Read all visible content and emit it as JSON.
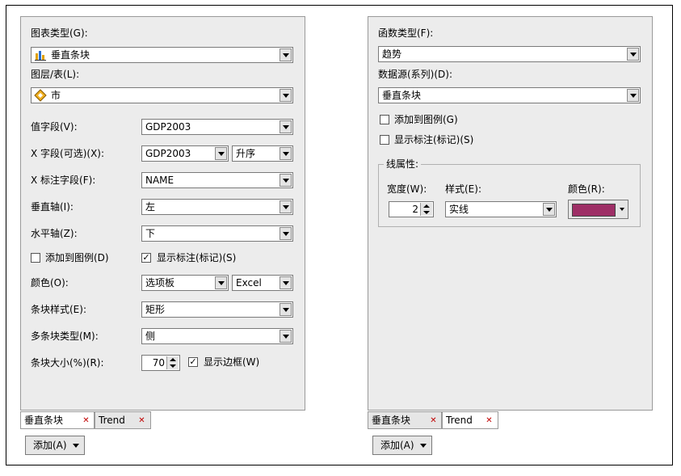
{
  "left": {
    "chart_type_label": "图表类型(G):",
    "chart_type_value": "垂直条块",
    "layer_label": "图层/表(L):",
    "layer_value": "市",
    "value_field_label": "值字段(V):",
    "value_field_value": "GDP2003",
    "x_field_label": "X 字段(可选)(X):",
    "x_field_value": "GDP2003",
    "sort_value": "升序",
    "x_label_field_label": "X 标注字段(F):",
    "x_label_field_value": "NAME",
    "vertical_axis_label": "垂直轴(I):",
    "vertical_axis_value": "左",
    "horizontal_axis_label": "水平轴(Z):",
    "horizontal_axis_value": "下",
    "add_legend_label": "添加到图例(D)",
    "add_legend_checked": "",
    "show_labels_label": "显示标注(标记)(S)",
    "show_labels_checked": "✓",
    "color_label": "颜色(O):",
    "color_scheme_value": "选项板",
    "palette_value": "Excel",
    "bar_style_label": "条块样式(E):",
    "bar_style_value": "矩形",
    "multi_bar_label": "多条块类型(M):",
    "multi_bar_value": "侧",
    "bar_size_label": "条块大小(%)(R):",
    "bar_size_value": "70",
    "show_border_label": "显示边框(W)",
    "show_border_checked": "✓",
    "tabs": [
      {
        "label": "垂直条块"
      },
      {
        "label": "Trend"
      }
    ],
    "add_button_label": "添加(A)"
  },
  "right": {
    "function_type_label": "函数类型(F):",
    "function_type_value": "趋势",
    "data_source_label": "数据源(系列)(D):",
    "data_source_value": "垂直条块",
    "add_legend_label": "添加到图例(G)",
    "add_legend_checked": "",
    "show_labels_label": "显示标注(标记)(S)",
    "show_labels_checked": "",
    "line_props_label": "线属性:",
    "width_label": "宽度(W):",
    "width_value": "2",
    "style_label": "样式(E):",
    "style_value": "实线",
    "color_label": "颜色(R):",
    "color_value": "#9e2f66",
    "tabs": [
      {
        "label": "垂直条块"
      },
      {
        "label": "Trend"
      }
    ],
    "add_button_label": "添加(A)"
  }
}
